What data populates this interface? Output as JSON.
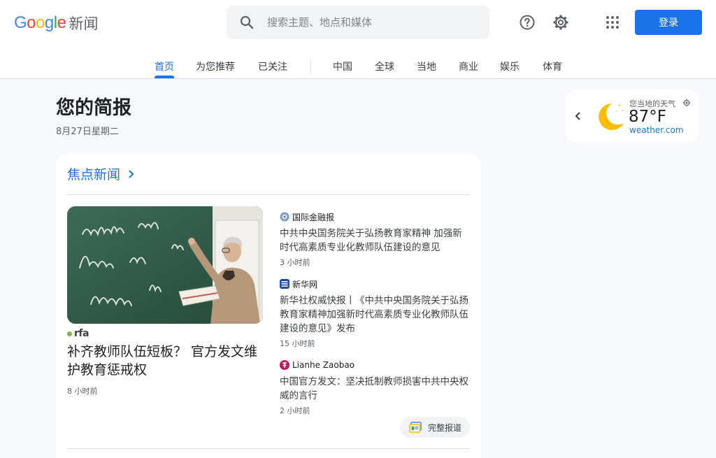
{
  "header": {
    "logo_text": "Google",
    "logo_suffix": "新闻",
    "search_placeholder": "搜索主题、地点和媒体",
    "login_label": "登录"
  },
  "tabs": [
    {
      "label": "首页",
      "active": true
    },
    {
      "label": "为您推荐"
    },
    {
      "label": "已关注"
    },
    {
      "label": "中国"
    },
    {
      "label": "全球"
    },
    {
      "label": "当地"
    },
    {
      "label": "商业"
    },
    {
      "label": "娱乐"
    },
    {
      "label": "体育"
    }
  ],
  "briefing": {
    "title": "您的简报",
    "date": "8月27日星期二"
  },
  "weather": {
    "label": "您当地的天气",
    "temperature": "87°F",
    "source": "weather.com"
  },
  "top_stories": {
    "heading": "焦点新闻",
    "main": {
      "source": "rfa",
      "headline": "补齐教师队伍短板？ 官方发文维护教育惩戒权",
      "time": "8 小时前"
    },
    "stories": [
      {
        "source": "国际金融报",
        "headline": "中共中央国务院关于弘扬教育家精神 加强新时代高素质专业化教师队伍建设的意见",
        "time": "3 小时前"
      },
      {
        "source": "新华网",
        "headline": "新华社权威快报丨《中共中央国务院关于弘扬教育家精神加强新时代高素质专业化教师队伍建设的意见》发布",
        "time": "15 小时前"
      },
      {
        "source": "Lianhe Zaobao",
        "headline": "中国官方发文：坚决抵制教师损害中共中央权威的言行",
        "time": "2 小时前"
      }
    ],
    "full_coverage_label": "完整报道"
  },
  "colors": {
    "accent": "#1a73e8",
    "background": "#f6f8fc",
    "card": "#ffffff",
    "moon": "#fbbc04"
  }
}
